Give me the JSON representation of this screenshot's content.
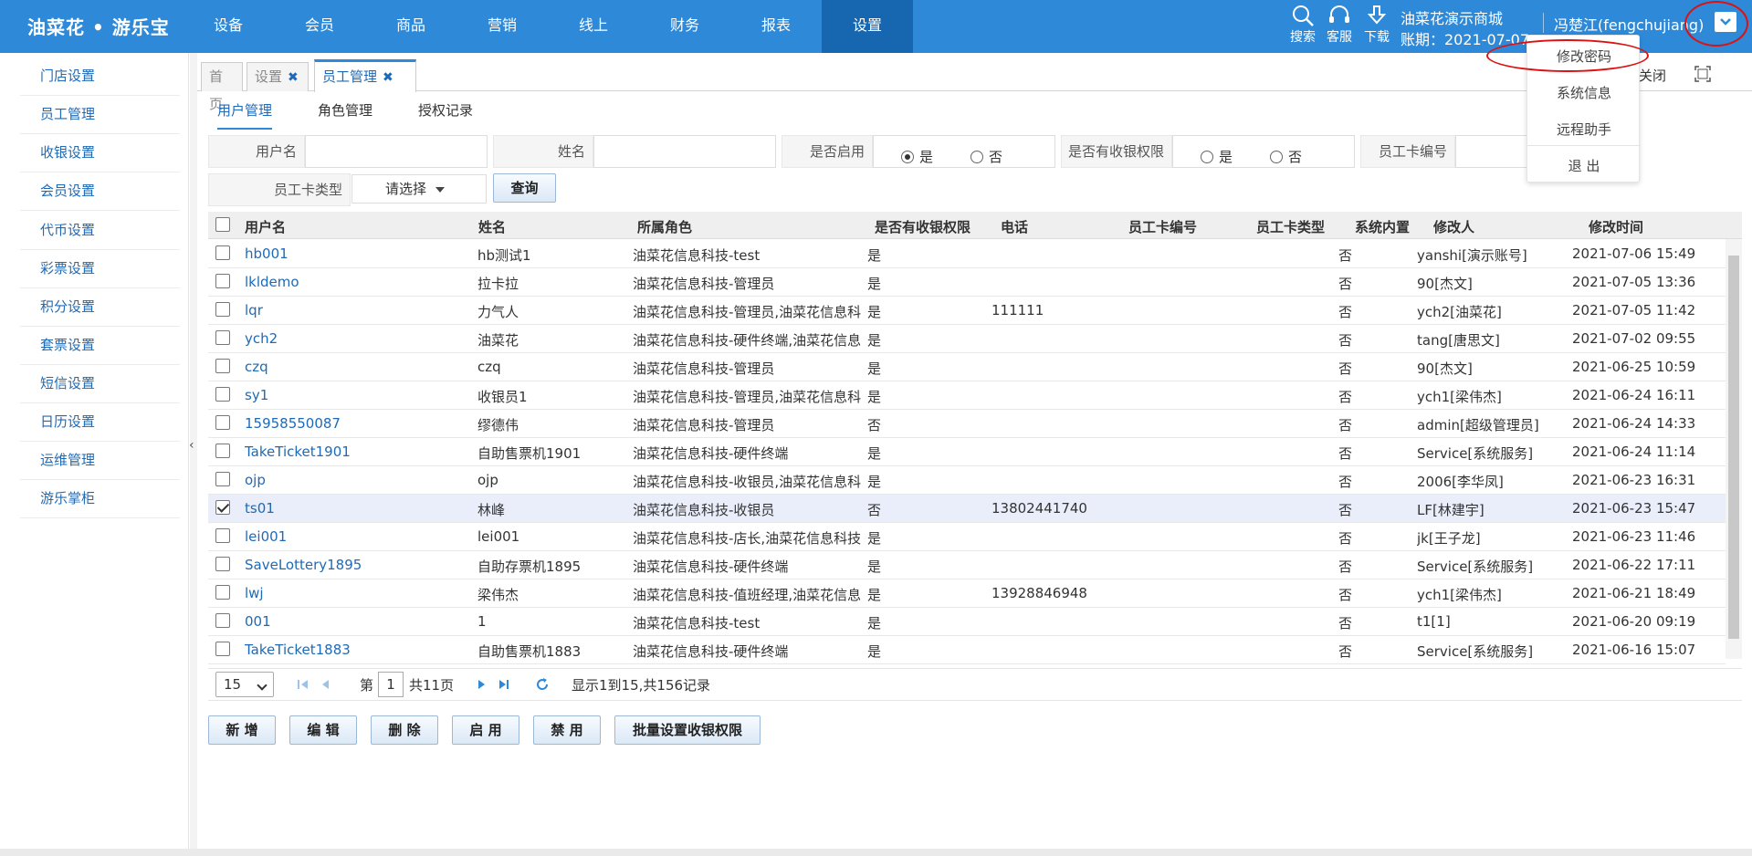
{
  "app": {
    "logo": "油菜花 • 游乐宝"
  },
  "nav": [
    "设备",
    "会员",
    "商品",
    "营销",
    "线上",
    "财务",
    "报表",
    "设置"
  ],
  "nav_active": 7,
  "tools": [
    {
      "label": "搜索",
      "icon": "search-icon"
    },
    {
      "label": "客服",
      "icon": "headset-icon"
    },
    {
      "label": "下载",
      "icon": "download-icon"
    }
  ],
  "header": {
    "shop": "油菜花演示商城",
    "period": "账期：2021-07-07",
    "user": "冯楚江(fengchujiang)"
  },
  "user_menu": [
    "修改密码",
    "系统信息",
    "远程助手",
    "退 出"
  ],
  "sidebar": [
    "门店设置",
    "员工管理",
    "收银设置",
    "会员设置",
    "代币设置",
    "彩票设置",
    "积分设置",
    "套票设置",
    "短信设置",
    "日历设置",
    "运维管理",
    "游乐掌柜"
  ],
  "tabs": [
    {
      "label": "首页"
    },
    {
      "label": "设置",
      "close": "✖"
    },
    {
      "label": "员工管理",
      "close": "✖"
    }
  ],
  "close_all": "关闭",
  "subtabs": [
    "用户管理",
    "角色管理",
    "授权记录"
  ],
  "filter": {
    "username_label": "用户名",
    "name_label": "姓名",
    "enabled_label": "是否启用",
    "cashier_label": "是否有收银权限",
    "card_no_label": "员工卡编号",
    "card_type_label": "员工卡类型",
    "yes": "是",
    "no": "否",
    "enabled_value": "是",
    "card_type_value": "请选择",
    "query_button": "查询"
  },
  "columns": [
    "用户名",
    "姓名",
    "所属角色",
    "是否有收银权限",
    "电话",
    "员工卡编号",
    "员工卡类型",
    "系统内置",
    "修改人",
    "修改时间"
  ],
  "rows": [
    [
      "hb001",
      "hb测试1",
      "油菜花信息科技-test",
      "是",
      "",
      "",
      "",
      "否",
      "yanshi[演示账号]",
      "2021-07-06 15:49"
    ],
    [
      "lkldemo",
      "拉卡拉",
      "油菜花信息科技-管理员",
      "是",
      "",
      "",
      "",
      "否",
      "90[杰文]",
      "2021-07-05 13:36"
    ],
    [
      "lqr",
      "力气人",
      "油菜花信息科技-管理员,油菜花信息科",
      "是",
      "111111",
      "",
      "",
      "否",
      "ych2[油菜花]",
      "2021-07-05 11:42"
    ],
    [
      "ych2",
      "油菜花",
      "油菜花信息科技-硬件终端,油菜花信息",
      "是",
      "",
      "",
      "",
      "否",
      "tang[唐思文]",
      "2021-07-02 09:55"
    ],
    [
      "czq",
      "czq",
      "油菜花信息科技-管理员",
      "是",
      "",
      "",
      "",
      "否",
      "90[杰文]",
      "2021-06-25 10:59"
    ],
    [
      "sy1",
      "收银员1",
      "油菜花信息科技-管理员,油菜花信息科",
      "是",
      "",
      "",
      "",
      "否",
      "ych1[梁伟杰]",
      "2021-06-24 16:11"
    ],
    [
      "15958550087",
      "缪德伟",
      "油菜花信息科技-管理员",
      "否",
      "",
      "",
      "",
      "否",
      "admin[超级管理员]",
      "2021-06-24 14:33"
    ],
    [
      "TakeTicket1901",
      "自助售票机1901",
      "油菜花信息科技-硬件终端",
      "是",
      "",
      "",
      "",
      "否",
      "Service[系统服务]",
      "2021-06-24 11:14"
    ],
    [
      "ojp",
      "ojp",
      "油菜花信息科技-收银员,油菜花信息科",
      "是",
      "",
      "",
      "",
      "否",
      "2006[李华凤]",
      "2021-06-23 16:31"
    ],
    [
      "ts01",
      "林峰",
      "油菜花信息科技-收银员",
      "否",
      "13802441740",
      "",
      "",
      "否",
      "LF[林建宇]",
      "2021-06-23 15:47"
    ],
    [
      "lei001",
      "lei001",
      "油菜花信息科技-店长,油菜花信息科技",
      "是",
      "",
      "",
      "",
      "否",
      "jk[王子龙]",
      "2021-06-23 11:46"
    ],
    [
      "SaveLottery1895",
      "自助存票机1895",
      "油菜花信息科技-硬件终端",
      "是",
      "",
      "",
      "",
      "否",
      "Service[系统服务]",
      "2021-06-22 17:11"
    ],
    [
      "lwj",
      "梁伟杰",
      "油菜花信息科技-值班经理,油菜花信息",
      "是",
      "13928846948",
      "",
      "",
      "否",
      "ych1[梁伟杰]",
      "2021-06-21 18:49"
    ],
    [
      "001",
      "1",
      "油菜花信息科技-test",
      "是",
      "",
      "",
      "",
      "否",
      "t1[1]",
      "2021-06-20 09:19"
    ],
    [
      "TakeTicket1883",
      "自助售票机1883",
      "油菜花信息科技-硬件终端",
      "是",
      "",
      "",
      "",
      "否",
      "Service[系统服务]",
      "2021-06-16 15:07"
    ]
  ],
  "selected_row": 9,
  "pager": {
    "size": "15",
    "page_prefix": "第",
    "page": "1",
    "page_suffix": "共11页",
    "info": "显示1到15,共156记录"
  },
  "actions": [
    "新 增",
    "编 辑",
    "删 除",
    "启 用",
    "禁 用",
    "批量设置收银权限"
  ]
}
